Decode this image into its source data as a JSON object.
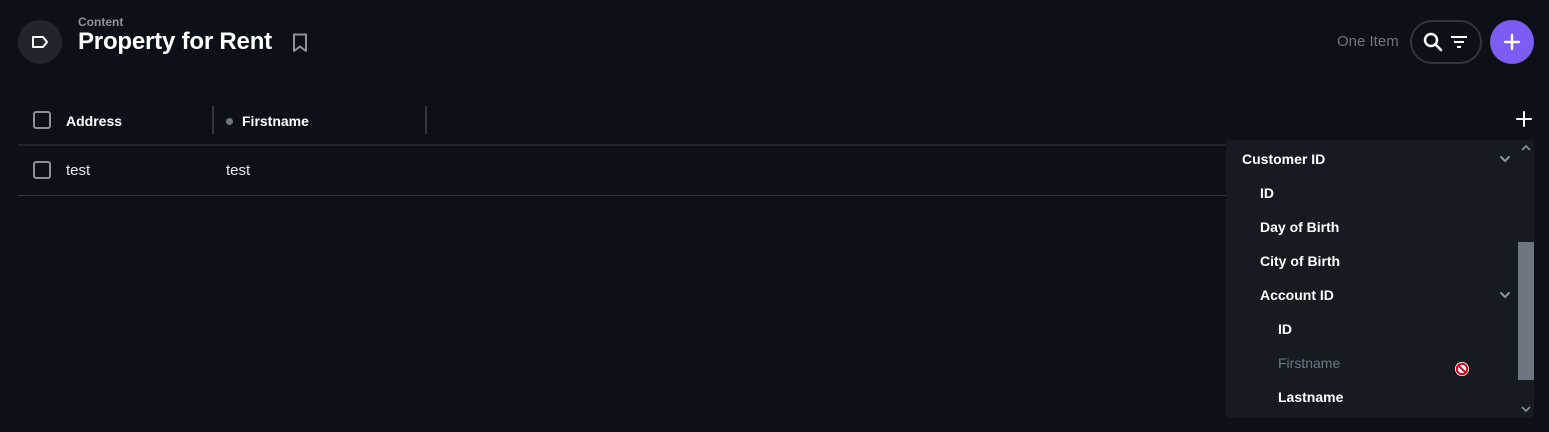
{
  "header": {
    "breadcrumb": "Content",
    "title": "Property for Rent",
    "item_count": "One Item"
  },
  "icons": {
    "collection": "collection-tag-icon",
    "bookmark": "bookmark-icon",
    "search": "search-icon",
    "filter": "filter-icon",
    "create": "plus-icon",
    "add_column": "plus-icon",
    "chevron": "chevron-down-icon",
    "cursor": "not-allowed-icon"
  },
  "colors": {
    "background": "#0d1117",
    "accent": "#7c5cf5",
    "muted": "#6e7681"
  },
  "table": {
    "columns": [
      "Address",
      "Firstname"
    ],
    "rows": [
      [
        "test",
        "test"
      ]
    ]
  },
  "dropdown": {
    "items": [
      {
        "label": "Customer ID",
        "level": 0,
        "expandable": true,
        "disabled": false
      },
      {
        "label": "ID",
        "level": 1,
        "expandable": false,
        "disabled": false
      },
      {
        "label": "Day of Birth",
        "level": 1,
        "expandable": false,
        "disabled": false
      },
      {
        "label": "City of Birth",
        "level": 1,
        "expandable": false,
        "disabled": false
      },
      {
        "label": "Account ID",
        "level": 1,
        "expandable": true,
        "disabled": false
      },
      {
        "label": "ID",
        "level": 2,
        "expandable": false,
        "disabled": false
      },
      {
        "label": "Firstname",
        "level": 2,
        "expandable": false,
        "disabled": true
      },
      {
        "label": "Lastname",
        "level": 2,
        "expandable": false,
        "disabled": false
      }
    ]
  }
}
